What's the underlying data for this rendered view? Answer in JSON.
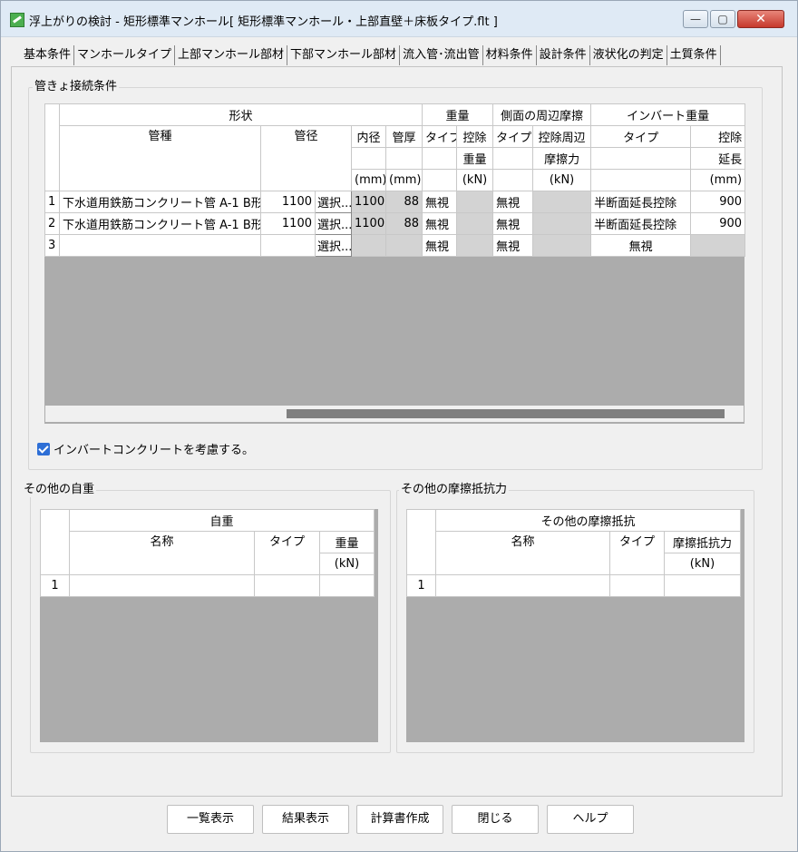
{
  "window": {
    "title": "浮上がりの検討 - 矩形標準マンホール[ 矩形標準マンホール・上部直壁＋床板タイプ.flt ]",
    "min_label": "—",
    "max_label": "▢",
    "close_label": "✕"
  },
  "tabs": [
    "基本条件",
    "マンホールタイプ",
    "上部マンホール部材",
    "下部マンホール部材",
    "流入管･流出管",
    "材料条件",
    "設計条件",
    "液状化の判定",
    "土質条件"
  ],
  "pipe_section": {
    "title": "管きょ接続条件",
    "headers": {
      "shape": "形状",
      "weight": "重量",
      "side_friction": "側面の周辺摩擦",
      "invert_weight": "インバート重量",
      "pipe_type": "管種",
      "diameter": "管径",
      "inner_dia": "内径",
      "thickness": "管厚",
      "type": "タイプ",
      "deduct": "控除",
      "weight2": "重量",
      "deduct_friction": "控除周辺",
      "friction_force": "摩擦力",
      "deduct_len": "控除",
      "length": "延長",
      "unit_mm": "(mm)",
      "unit_kn": "(kN)"
    },
    "rows": [
      {
        "no": "1",
        "pipe": "下水道用鉄筋コンクリート管 A-1 B形",
        "diameter": "1100",
        "select": "選択...",
        "inner": "1100",
        "thick": "88",
        "wtype": "無視",
        "ftype": "無視",
        "itype": "半断面延長控除",
        "ilen": "900"
      },
      {
        "no": "2",
        "pipe": "下水道用鉄筋コンクリート管 A-1 B形",
        "diameter": "1100",
        "select": "選択...",
        "inner": "1100",
        "thick": "88",
        "wtype": "無視",
        "ftype": "無視",
        "itype": "半断面延長控除",
        "ilen": "900"
      },
      {
        "no": "3",
        "pipe": "",
        "diameter": "",
        "select": "選択...",
        "inner": "",
        "thick": "",
        "wtype": "無視",
        "ftype": "無視",
        "itype": "無視",
        "ilen": ""
      }
    ],
    "checkbox_label": "インバートコンクリートを考慮する。",
    "checkbox_checked": true
  },
  "self_weight": {
    "title": "その他の自重",
    "header_group": "自重",
    "name": "名称",
    "type": "タイプ",
    "weight": "重量",
    "unit": "(kN)",
    "rows": [
      {
        "no": "1"
      }
    ]
  },
  "friction": {
    "title": "その他の摩擦抵抗力",
    "header_group": "その他の摩擦抵抗",
    "name": "名称",
    "type": "タイプ",
    "force": "摩擦抵抗力",
    "unit": "(kN)",
    "rows": [
      {
        "no": "1"
      }
    ]
  },
  "buttons": {
    "list": "一覧表示",
    "result": "結果表示",
    "report": "計算書作成",
    "close": "閉じる",
    "help": "ヘルプ"
  }
}
